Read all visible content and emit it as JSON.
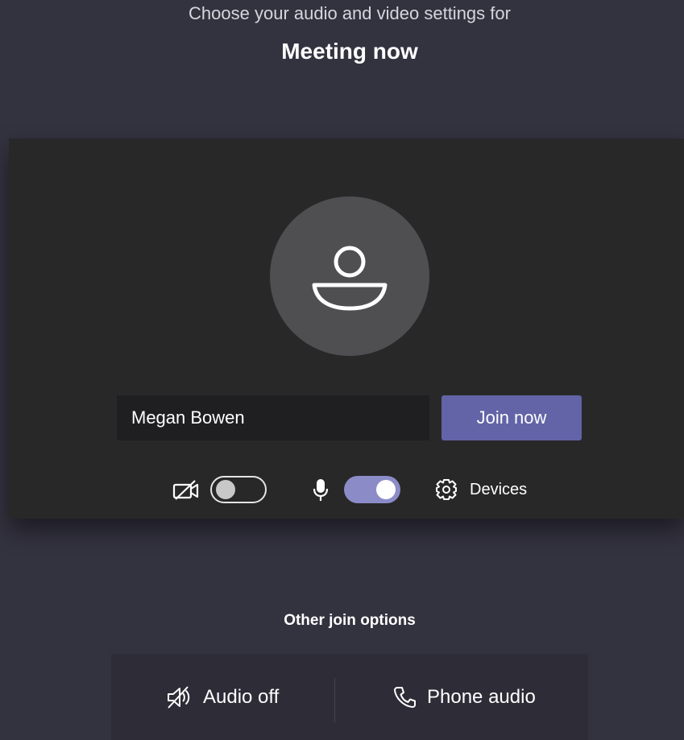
{
  "header": {
    "subtitle": "Choose your audio and video settings for",
    "meeting_title": "Meeting now"
  },
  "preview": {
    "avatar_icon": "person-icon",
    "name_value": "Megan Bowen",
    "join_label": "Join now"
  },
  "controls": {
    "camera": {
      "icon": "camera-off-icon",
      "state": "off"
    },
    "microphone": {
      "icon": "microphone-icon",
      "state": "on"
    },
    "devices": {
      "icon": "gear-icon",
      "label": "Devices"
    }
  },
  "other_options": {
    "title": "Other join options",
    "items": [
      {
        "icon": "speaker-off-icon",
        "label": "Audio off"
      },
      {
        "icon": "phone-icon",
        "label": "Phone audio"
      }
    ]
  },
  "colors": {
    "background": "#33323f",
    "card": "#292829",
    "accent": "#6264a7",
    "toggle_on": "#8b8cc7"
  }
}
